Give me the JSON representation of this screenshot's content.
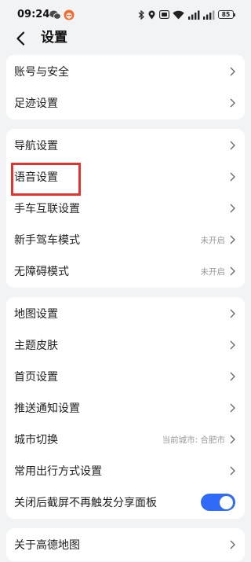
{
  "status_bar": {
    "time": "09:24",
    "battery_level": "85",
    "icons": [
      "wechat-icon",
      "app-notification-icon",
      "bluetooth-icon",
      "location-icon",
      "hd-icon",
      "wifi-icon",
      "signal-icon",
      "signal-icon",
      "battery-icon"
    ]
  },
  "header": {
    "title": "设置",
    "back_icon": "chevron-left-icon"
  },
  "groups": [
    {
      "items": [
        {
          "label": "账号与安全"
        },
        {
          "label": "足迹设置"
        }
      ]
    },
    {
      "items": [
        {
          "label": "导航设置"
        },
        {
          "label": "语音设置",
          "highlighted": true
        },
        {
          "label": "手车互联设置"
        },
        {
          "label": "新手驾车模式",
          "value": "未开启"
        },
        {
          "label": "无障碍模式",
          "value": "未开启"
        }
      ]
    },
    {
      "items": [
        {
          "label": "地图设置"
        },
        {
          "label": "主题皮肤"
        },
        {
          "label": "首页设置"
        },
        {
          "label": "推送通知设置"
        },
        {
          "label": "城市切换",
          "value": "当前城市: 合肥市"
        },
        {
          "label": "常用出行方式设置"
        },
        {
          "label": "关闭后截屏不再触发分享面板",
          "toggle_on": true
        }
      ]
    },
    {
      "items": [
        {
          "label": "关于高德地图"
        }
      ]
    }
  ],
  "row_trailing_icon": "chevron-right-icon",
  "colors": {
    "background": "#f2f3f5",
    "card": "#ffffff",
    "text": "#1f1f1f",
    "secondary_text": "#9a9a9a",
    "accent": "#2f6bf6",
    "annotation": "#e5322d"
  }
}
